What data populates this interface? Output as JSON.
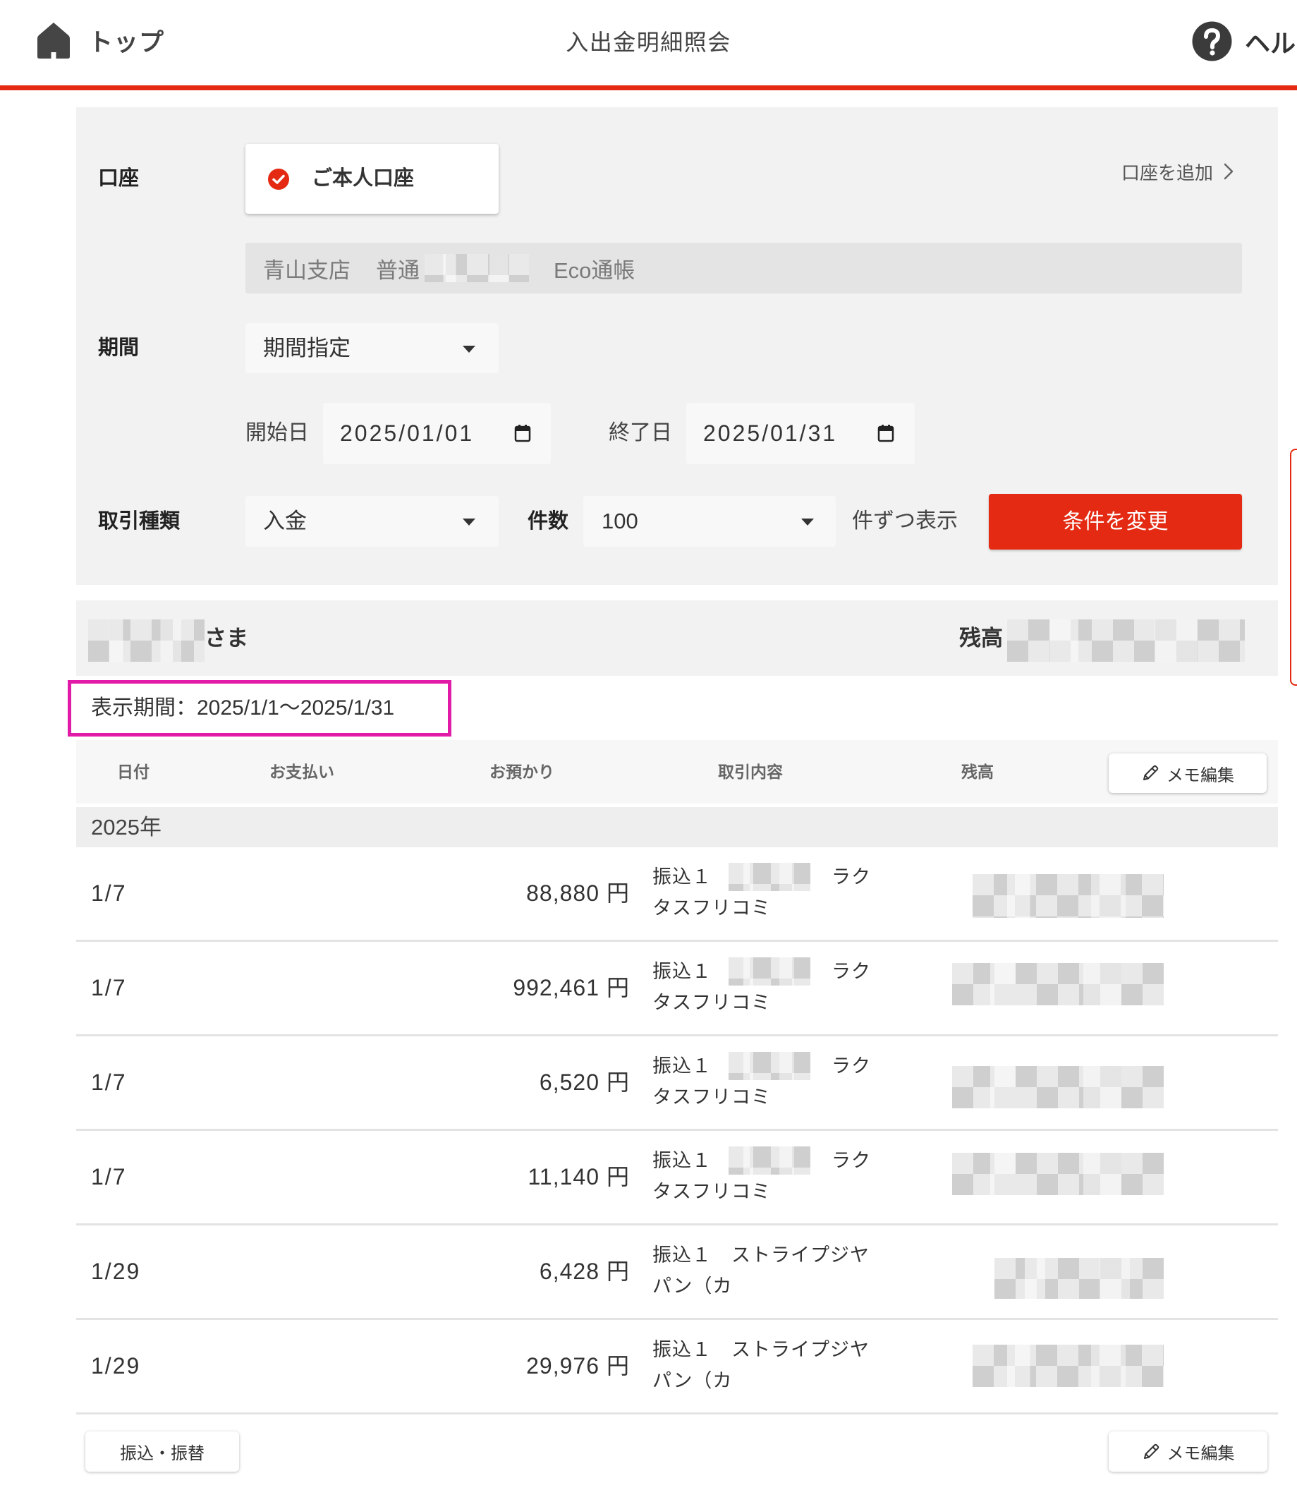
{
  "header": {
    "home_label": "トップ",
    "title": "入出金明細照会",
    "help_label": "ヘル"
  },
  "filter": {
    "account_label": "口座",
    "account_option": "ご本人口座",
    "account_option_checked": true,
    "add_account_link": "口座を追加",
    "account_branch": "青山支店",
    "account_type": "普通",
    "account_passbook": "Eco通帳",
    "period_label": "期間",
    "period_select": "期間指定",
    "start_date_label": "開始日",
    "start_date_value": "2025/01/01",
    "end_date_label": "終了日",
    "end_date_value": "2025/01/31",
    "type_label": "取引種類",
    "type_select": "入金",
    "count_label": "件数",
    "count_select": "100",
    "count_suffix": "件ずつ表示",
    "submit_label": "条件を変更"
  },
  "summary": {
    "name_suffix": "さま",
    "balance_label": "残高"
  },
  "display_period": "表示期間：2025/1/1〜2025/1/31",
  "table": {
    "columns": {
      "date": "日付",
      "payment": "お支払い",
      "deposit": "お預かり",
      "description": "取引内容",
      "balance": "残高"
    },
    "memo_edit_label": "メモ編集",
    "year_label": "2025年",
    "currency": "円",
    "rows": [
      {
        "date": "1/7",
        "deposit": "88,880",
        "desc_line1_start": "振込１",
        "desc_line1_end": "ラク",
        "desc_line2": "タスフリコミ"
      },
      {
        "date": "1/7",
        "deposit": "992,461",
        "desc_line1_start": "振込１",
        "desc_line1_end": "ラク",
        "desc_line2": "タスフリコミ"
      },
      {
        "date": "1/7",
        "deposit": "6,520",
        "desc_line1_start": "振込１",
        "desc_line1_end": "ラク",
        "desc_line2": "タスフリコミ"
      },
      {
        "date": "1/7",
        "deposit": "11,140",
        "desc_line1_start": "振込１",
        "desc_line1_end": "ラク",
        "desc_line2": "タスフリコミ"
      },
      {
        "date": "1/29",
        "deposit": "6,428",
        "desc_line1_start": "振込１　ストライプジヤ",
        "desc_line2": "パン（カ"
      },
      {
        "date": "1/29",
        "deposit": "29,976",
        "desc_line1_start": "振込１　ストライプジヤ",
        "desc_line2": "パン（カ"
      }
    ]
  },
  "footer": {
    "transfer_label": "振込・振替",
    "memo_edit_label": "メモ編集"
  },
  "icons": {
    "home": "home-icon",
    "help": "help-icon",
    "account_check": "check-circle-icon",
    "add_account": "chevron-right-icon",
    "date_picker": "calendar-icon",
    "dropdown": "caret-down-icon",
    "memo_edit": "pencil-icon"
  },
  "colors": {
    "accent_red": "#e42a12",
    "highlight_magenta": "#e21aa8",
    "panel_background": "#f2f2f2",
    "text_primary": "#333333"
  }
}
